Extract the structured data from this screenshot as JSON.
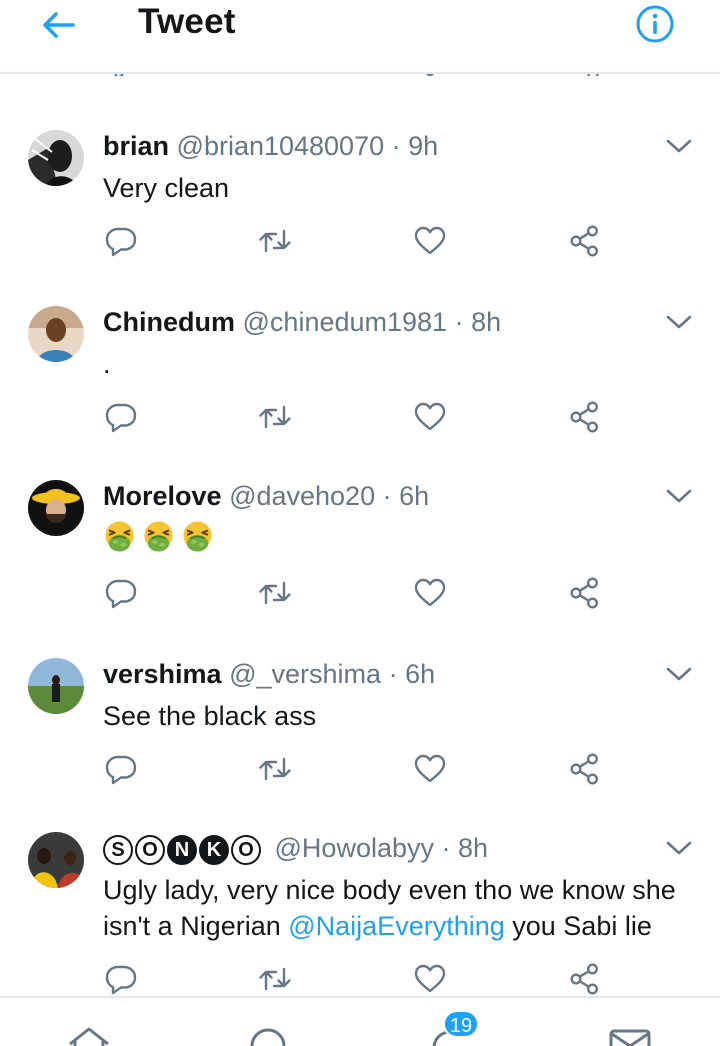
{
  "header": {
    "title": "Tweet",
    "back_icon": "arrow-left-icon",
    "info_icon": "info-icon"
  },
  "colors": {
    "accent": "#1da1f2",
    "secondary_text": "#657786",
    "divider": "#e1e8ed"
  },
  "replies": [
    {
      "name": "brian",
      "handle": "@brian10480070",
      "dot": "·",
      "time": "9h",
      "text": "Very clean"
    },
    {
      "name": "Chinedum",
      "handle": "@chinedum1981",
      "dot": "·",
      "time": "8h",
      "text": "."
    },
    {
      "name": "Morelove",
      "handle": "@daveho20",
      "dot": "·",
      "time": "6h",
      "emojis": [
        "nauseated-face",
        "nauseated-face",
        "nauseated-face"
      ]
    },
    {
      "name": "vershima",
      "handle": "@_vershima",
      "dot": "·",
      "time": "6h",
      "text": "See the black ass"
    },
    {
      "name_letters": [
        "S",
        "O",
        "N",
        "K",
        "O"
      ],
      "handle": "@Howolabyy",
      "dot": "·",
      "time": "8h",
      "text_before": "Ugly lady, very nice body even tho we know she isn't a Nigerian ",
      "mention": "@NaijaEverything",
      "text_after": " you Sabi lie"
    }
  ],
  "bottom_nav": {
    "items": [
      "home-icon",
      "search-icon",
      "notifications-icon",
      "messages-icon"
    ],
    "notification_count": "19"
  }
}
